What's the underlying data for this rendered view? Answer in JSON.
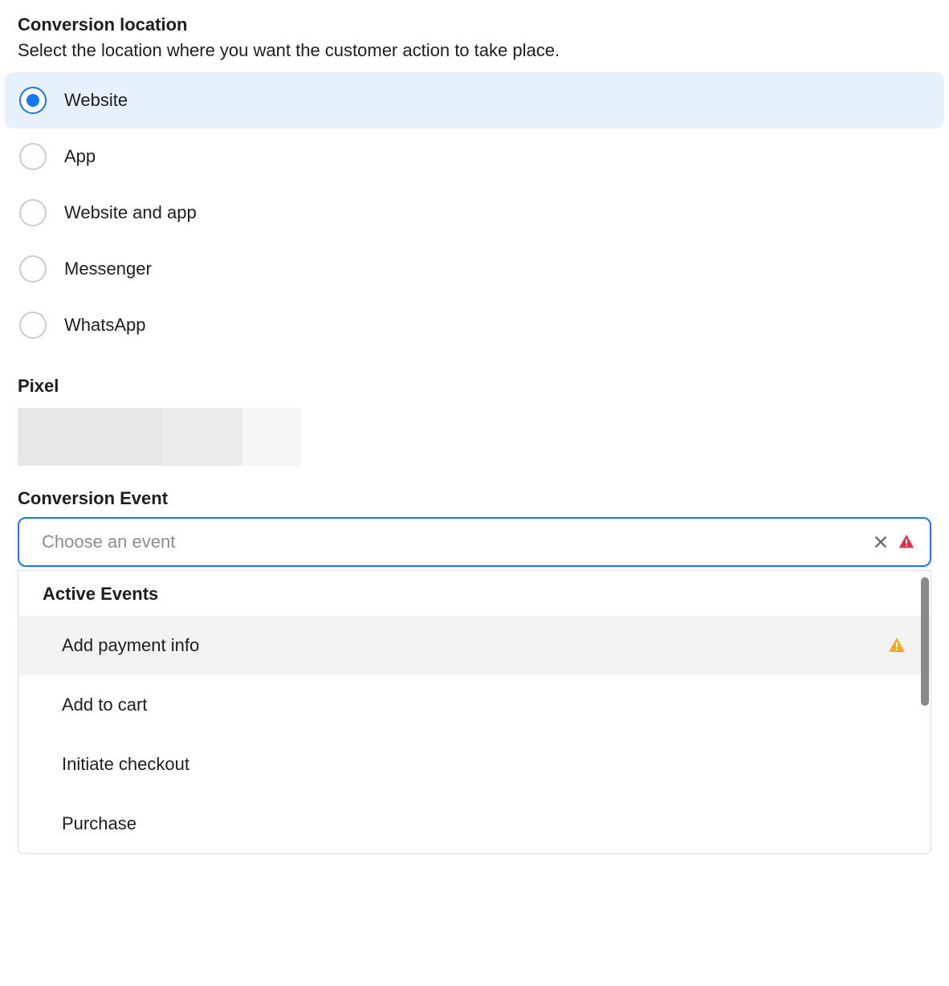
{
  "conversionLocation": {
    "title": "Conversion location",
    "subtitle": "Select the location where you want the customer action to take place.",
    "options": [
      {
        "label": "Website",
        "selected": true
      },
      {
        "label": "App",
        "selected": false
      },
      {
        "label": "Website and app",
        "selected": false
      },
      {
        "label": "Messenger",
        "selected": false
      },
      {
        "label": "WhatsApp",
        "selected": false
      }
    ]
  },
  "pixel": {
    "title": "Pixel"
  },
  "conversionEvent": {
    "title": "Conversion Event",
    "placeholder": "Choose an event",
    "value": "",
    "dropdownHeader": "Active Events",
    "options": [
      {
        "label": "Add payment info",
        "warning": true,
        "highlighted": true
      },
      {
        "label": "Add to cart",
        "warning": false,
        "highlighted": false
      },
      {
        "label": "Initiate checkout",
        "warning": false,
        "highlighted": false
      },
      {
        "label": "Purchase",
        "warning": false,
        "highlighted": false
      }
    ]
  }
}
